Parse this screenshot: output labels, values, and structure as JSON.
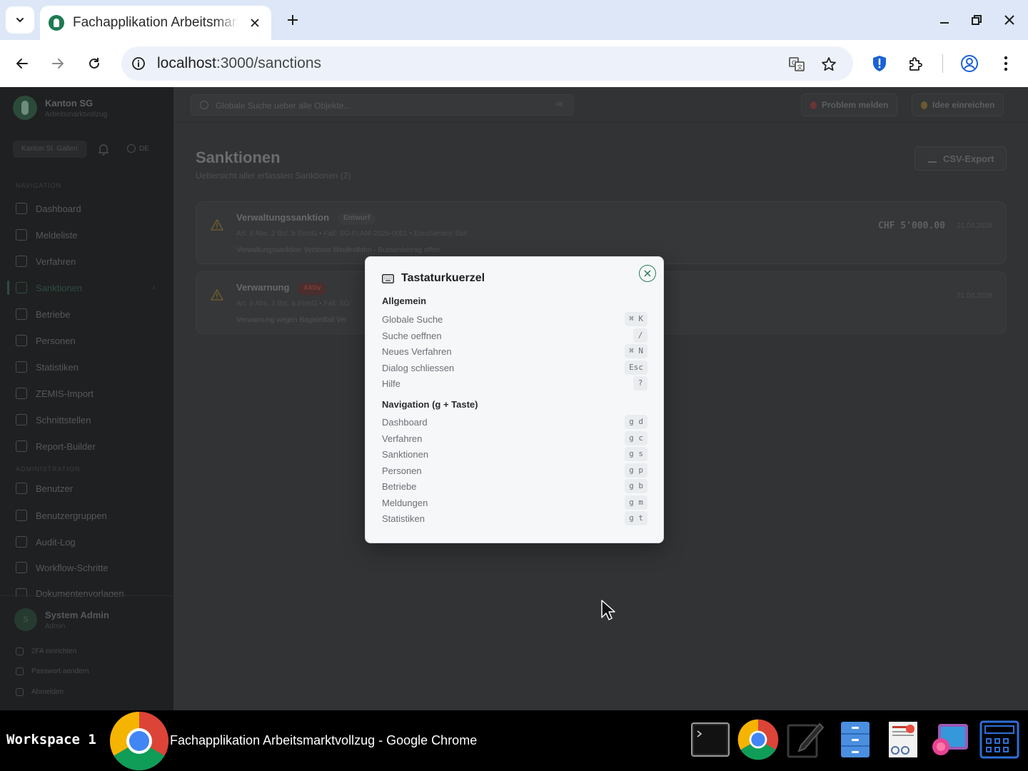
{
  "browser": {
    "tab_title": "Fachapplikation Arbeitsmarktvollzug",
    "url_host": "localhost",
    "url_path": ":3000/sanctions"
  },
  "sidebar": {
    "org_name": "Kanton SG",
    "org_sub": "Arbeitsmarktvollzug",
    "canton": "Kanton St. Gallen",
    "lang": "DE",
    "section_navigation": "Navigation",
    "section_admin": "Administration",
    "nav": [
      {
        "label": "Dashboard",
        "icon": "dashboard-icon"
      },
      {
        "label": "Meldeliste",
        "icon": "inbox-icon"
      },
      {
        "label": "Verfahren",
        "icon": "file-icon"
      },
      {
        "label": "Sanktionen",
        "icon": "warning-icon"
      },
      {
        "label": "Betriebe",
        "icon": "building-icon"
      },
      {
        "label": "Personen",
        "icon": "user-icon"
      },
      {
        "label": "Statistiken",
        "icon": "bar-chart-icon"
      },
      {
        "label": "ZEMIS-Import",
        "icon": "upload-icon"
      },
      {
        "label": "Schnittstellen",
        "icon": "globe-icon"
      },
      {
        "label": "Report-Builder",
        "icon": "report-icon"
      }
    ],
    "admin": [
      {
        "label": "Benutzer",
        "icon": "user-icon"
      },
      {
        "label": "Benutzergruppen",
        "icon": "users-icon"
      },
      {
        "label": "Audit-Log",
        "icon": "history-icon"
      },
      {
        "label": "Workflow-Schritte",
        "icon": "list-icon"
      },
      {
        "label": "Dokumentenvorlagen",
        "icon": "document-icon"
      }
    ],
    "user_name": "System Admin",
    "user_role": "Admin",
    "user_initial": "S",
    "links": [
      "2FA einrichten",
      "Passwort aendern",
      "Abmelden"
    ]
  },
  "topbar": {
    "search_placeholder": "Globale Suche ueber alle Objekte...",
    "search_kbd": "⌘K",
    "report_problem": "Problem melden",
    "submit_idea": "Idee einreichen"
  },
  "page": {
    "title": "Sanktionen",
    "subtitle": "Uebersicht aller erfassten Sanktionen (2)",
    "csv_export": "CSV-Export"
  },
  "sanctions": [
    {
      "title": "Verwaltungssanktion",
      "status": "Entwurf",
      "meta": "Art. 9 Abs. 2 Bst. b EntsG • Fall: SG-FLAM-2026-0001 • EuroService Sàrl",
      "desc": "Verwaltungssanktion Verstoss Mindestlohn - Bussenbetrag offen",
      "amount": "CHF 5'000.00",
      "date": "21.04.2026"
    },
    {
      "title": "Verwarnung",
      "status": "Aktiv",
      "meta": "Art. 9 Abs. 2 Bst. a EntsG • Fall: SG",
      "desc": "Verwarnung wegen Bagatellfall Ver",
      "amount": "",
      "date": "21.04.2026"
    }
  ],
  "shortcuts": {
    "title": "Tastaturkuerzel",
    "group_general": "Allgemein",
    "general": [
      {
        "label": "Globale Suche",
        "key": "⌘ K"
      },
      {
        "label": "Suche oeffnen",
        "key": "/"
      },
      {
        "label": "Neues Verfahren",
        "key": "⌘ N"
      },
      {
        "label": "Dialog schliessen",
        "key": "Esc"
      },
      {
        "label": "Hilfe",
        "key": "?"
      }
    ],
    "group_nav": "Navigation (g + Taste)",
    "nav": [
      {
        "label": "Dashboard",
        "key": "g d"
      },
      {
        "label": "Verfahren",
        "key": "g c"
      },
      {
        "label": "Sanktionen",
        "key": "g s"
      },
      {
        "label": "Personen",
        "key": "g p"
      },
      {
        "label": "Betriebe",
        "key": "g b"
      },
      {
        "label": "Meldungen",
        "key": "g m"
      },
      {
        "label": "Statistiken",
        "key": "g t"
      }
    ]
  },
  "taskbar": {
    "workspace": "Workspace 1",
    "window_title": "Fachapplikation Arbeitsmarktvollzug - Google Chrome"
  },
  "colors": {
    "accent": "#2f7a5b",
    "draft_badge": "#3a3b3d",
    "active_badge": "#4a2e2e",
    "warning": "#6b5a2e"
  }
}
